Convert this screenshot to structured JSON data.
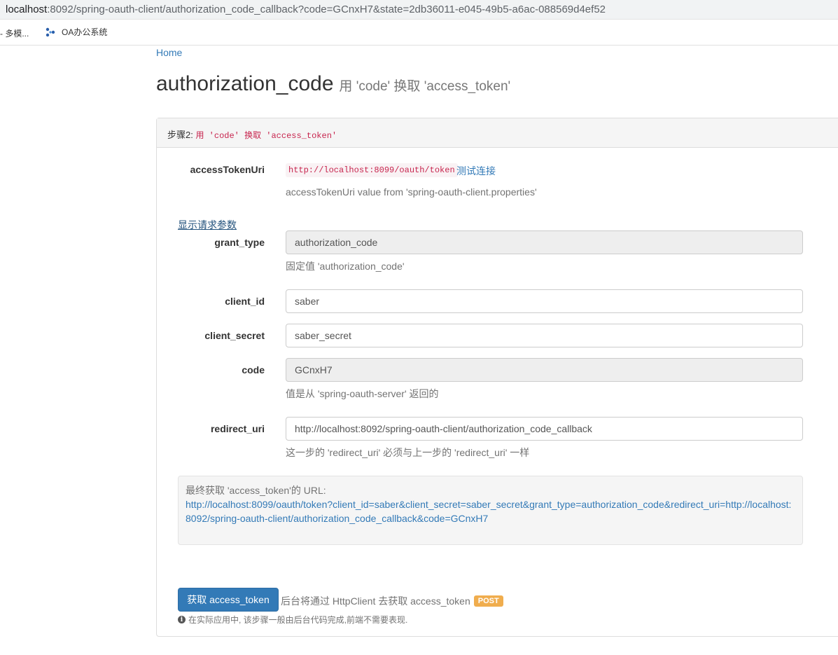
{
  "browser": {
    "url_host": "localhost",
    "url_rest": ":8092/spring-oauth-client/authorization_code_callback?code=GCnxH7&state=2db36011-e045-49b5-a6ac-088569d4ef52",
    "bookmarks": [
      {
        "label": "- 多模..."
      },
      {
        "label": "OA办公系统"
      }
    ]
  },
  "nav": {
    "home": "Home"
  },
  "header": {
    "title": "authorization_code",
    "subtitle": "用 'code' 换取 'access_token'"
  },
  "panel": {
    "step_prefix": "步骤2: ",
    "step_code": "用 'code' 换取 'access_token'"
  },
  "access_token_uri": {
    "label": "accessTokenUri",
    "value": "http://localhost:8099/oauth/token",
    "test_link": "测试连接",
    "help": "accessTokenUri value from 'spring-oauth-client.properties'"
  },
  "toggle_params": "显示请求参数",
  "fields": {
    "grant_type": {
      "label": "grant_type",
      "value": "authorization_code",
      "help": "固定值 'authorization_code'"
    },
    "client_id": {
      "label": "client_id",
      "value": "saber"
    },
    "client_secret": {
      "label": "client_secret",
      "value": "saber_secret"
    },
    "code": {
      "label": "code",
      "value": "GCnxH7",
      "help": "值是从 'spring-oauth-server' 返回的"
    },
    "redirect_uri": {
      "label": "redirect_uri",
      "value": "http://localhost:8092/spring-oauth-client/authorization_code_callback",
      "help": "这一步的 'redirect_uri' 必须与上一步的 'redirect_uri' 一样"
    }
  },
  "final_url": {
    "caption": "最终获取 'access_token'的 URL:",
    "url": "http://localhost:8099/oauth/token?client_id=saber&client_secret=saber_secret&grant_type=authorization_code&redirect_uri=http://localhost:8092/spring-oauth-client/authorization_code_callback&code=GCnxH7"
  },
  "actions": {
    "submit_label": "获取 access_token",
    "submit_desc": "后台将通过 HttpClient 去获取 access_token",
    "method_badge": "POST",
    "note": "在实际应用中, 该步骤一般由后台代码完成,前端不需要表现."
  },
  "colors": {
    "link": "#337ab7",
    "primary": "#337ab7",
    "warning": "#f0ad4e",
    "code_red": "#c7254e"
  }
}
